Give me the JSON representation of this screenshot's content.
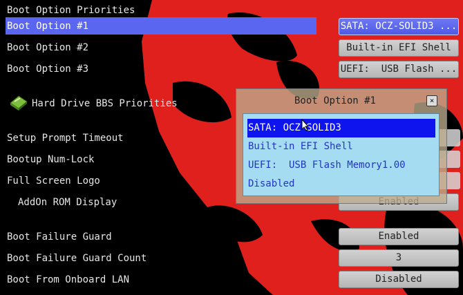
{
  "section_title": "Boot Option Priorities",
  "boot_options": [
    {
      "label": "Boot Option #1",
      "value": "SATA: OCZ-SOLID3 ..."
    },
    {
      "label": "Boot Option #2",
      "value": "Built-in EFI Shell"
    },
    {
      "label": "Boot Option #3",
      "value": "UEFI:  USB Flash ..."
    }
  ],
  "hdd_bbs_label": "Hard Drive BBS Priorities",
  "settings": {
    "setup_prompt_timeout": "Setup Prompt Timeout",
    "bootup_numlock": "Bootup Num-Lock",
    "full_screen_logo": "Full Screen Logo",
    "addon_rom_display": "AddOn ROM Display",
    "addon_rom_display_value": "Enabled"
  },
  "boot_failure": {
    "guard_label": "Boot Failure Guard",
    "guard_value": "Enabled",
    "count_label": "Boot Failure Guard Count",
    "count_value": "3",
    "lan_label": "Boot From Onboard LAN",
    "lan_value": "Disabled"
  },
  "popup": {
    "title": "Boot Option #1",
    "close_symbol": "×",
    "options": [
      "SATA: OCZ-SOLID3",
      "Built-in EFI Shell",
      "UEFI:  USB Flash Memory1.00",
      "Disabled"
    ],
    "selected_option": "SATA: OCZ-SOLID3"
  },
  "icons": {
    "hdd": "hard-drive-icon",
    "close": "close-icon",
    "cursor": "mouse-cursor-icon"
  },
  "colors": {
    "highlight": "#5a66f0",
    "popup_selected": "#0d14ee",
    "popup_list_bg": "#a6dcf2",
    "background_red": "#e0201c"
  }
}
